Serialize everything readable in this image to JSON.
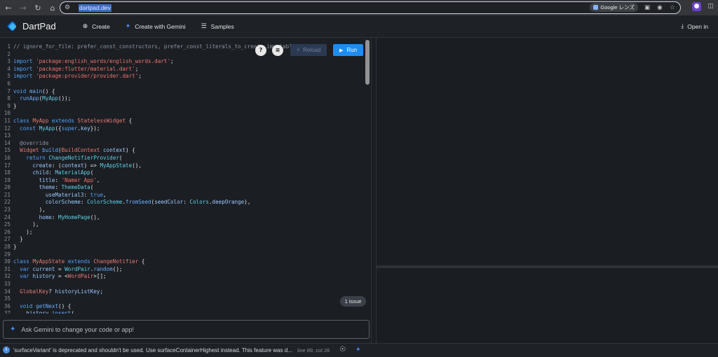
{
  "browser": {
    "url": "dartpad.dev",
    "lens_label": "Google レンズ",
    "icons": [
      "back-icon",
      "forward-icon",
      "reload-icon",
      "home-icon",
      "site-settings-icon",
      "lens-icon",
      "screenshot-icon",
      "incognito-off-icon",
      "bookmark-star-icon",
      "extension-profile-icon",
      "extensions-icon"
    ]
  },
  "header": {
    "brand": "DartPad",
    "create": "Create",
    "create_gemini": "Create with Gemini",
    "samples": "Samples",
    "open_in": "Open in"
  },
  "editor": {
    "reload_label": "Reload",
    "run_label": "Run",
    "issues_label": "1 issue",
    "accent": "#1f8cf0",
    "lines": [
      [
        [
          "c-com",
          "// ignore_for_file: prefer_const_constructors, prefer_const_literals_to_create_immutables"
        ]
      ],
      [],
      [
        [
          "c-kw",
          "import "
        ],
        [
          "c-str",
          "'package:english_words/english_words.dart'"
        ],
        [
          "c-plain",
          ";"
        ]
      ],
      [
        [
          "c-kw",
          "import "
        ],
        [
          "c-str",
          "'package:flutter/material.dart'"
        ],
        [
          "c-plain",
          ";"
        ]
      ],
      [
        [
          "c-kw",
          "import "
        ],
        [
          "c-str",
          "'package:provider/provider.dart'"
        ],
        [
          "c-plain",
          ";"
        ]
      ],
      [],
      [
        [
          "c-kw",
          "void "
        ],
        [
          "c-fn",
          "main"
        ],
        [
          "c-plain",
          "() {"
        ]
      ],
      [
        [
          "c-plain",
          "  "
        ],
        [
          "c-fn",
          "runApp"
        ],
        [
          "c-plain",
          "("
        ],
        [
          "c-cls",
          "MyApp"
        ],
        [
          "c-plain",
          "());"
        ]
      ],
      [
        [
          "c-plain",
          "}"
        ]
      ],
      [],
      [
        [
          "c-kw",
          "class "
        ],
        [
          "c-var",
          "MyApp "
        ],
        [
          "c-kw",
          "extends "
        ],
        [
          "c-var",
          "StatelessWidget "
        ],
        [
          "c-plain",
          "{"
        ]
      ],
      [
        [
          "c-plain",
          "  "
        ],
        [
          "c-kw",
          "const "
        ],
        [
          "c-cls",
          "MyApp"
        ],
        [
          "c-plain",
          "({"
        ],
        [
          "c-kw",
          "super"
        ],
        [
          "c-plain",
          "."
        ],
        [
          "c-prop",
          "key"
        ],
        [
          "c-plain",
          "});"
        ]
      ],
      [],
      [
        [
          "c-anno",
          "  @override"
        ]
      ],
      [
        [
          "c-plain",
          "  "
        ],
        [
          "c-var",
          "Widget "
        ],
        [
          "c-fn",
          "build"
        ],
        [
          "c-plain",
          "("
        ],
        [
          "c-var",
          "BuildContext "
        ],
        [
          "c-prop",
          "context"
        ],
        [
          "c-plain",
          ") {"
        ]
      ],
      [
        [
          "c-plain",
          "    "
        ],
        [
          "c-kw",
          "return "
        ],
        [
          "c-cls",
          "ChangeNotifierProvider"
        ],
        [
          "c-plain",
          "("
        ]
      ],
      [
        [
          "c-plain",
          "      "
        ],
        [
          "c-prop",
          "create"
        ],
        [
          "c-plain",
          ": ("
        ],
        [
          "c-prop",
          "context"
        ],
        [
          "c-plain",
          ") => "
        ],
        [
          "c-cls",
          "MyAppState"
        ],
        [
          "c-plain",
          "(),"
        ]
      ],
      [
        [
          "c-plain",
          "      "
        ],
        [
          "c-prop",
          "child"
        ],
        [
          "c-plain",
          ": "
        ],
        [
          "c-cls",
          "MaterialApp"
        ],
        [
          "c-plain",
          "("
        ]
      ],
      [
        [
          "c-plain",
          "        "
        ],
        [
          "c-prop",
          "title"
        ],
        [
          "c-plain",
          ": "
        ],
        [
          "c-str",
          "'Namer App'"
        ],
        [
          "c-plain",
          ","
        ]
      ],
      [
        [
          "c-plain",
          "        "
        ],
        [
          "c-prop",
          "theme"
        ],
        [
          "c-plain",
          ": "
        ],
        [
          "c-cls",
          "ThemeData"
        ],
        [
          "c-plain",
          "("
        ]
      ],
      [
        [
          "c-plain",
          "          "
        ],
        [
          "c-prop",
          "useMaterial3"
        ],
        [
          "c-plain",
          ": "
        ],
        [
          "c-kw",
          "true"
        ],
        [
          "c-plain",
          ","
        ]
      ],
      [
        [
          "c-plain",
          "          "
        ],
        [
          "c-prop",
          "colorScheme"
        ],
        [
          "c-plain",
          ": "
        ],
        [
          "c-cls",
          "ColorScheme"
        ],
        [
          "c-plain",
          "."
        ],
        [
          "c-fn",
          "fromSeed"
        ],
        [
          "c-plain",
          "("
        ],
        [
          "c-prop",
          "seedColor"
        ],
        [
          "c-plain",
          ": "
        ],
        [
          "c-cls",
          "Colors"
        ],
        [
          "c-plain",
          "."
        ],
        [
          "c-prop",
          "deepOrange"
        ],
        [
          "c-plain",
          "),"
        ]
      ],
      [
        [
          "c-plain",
          "        ),"
        ]
      ],
      [
        [
          "c-plain",
          "        "
        ],
        [
          "c-prop",
          "home"
        ],
        [
          "c-plain",
          ": "
        ],
        [
          "c-cls",
          "MyHomePage"
        ],
        [
          "c-plain",
          "(),"
        ]
      ],
      [
        [
          "c-plain",
          "      ),"
        ]
      ],
      [
        [
          "c-plain",
          "    );"
        ]
      ],
      [
        [
          "c-plain",
          "  }"
        ]
      ],
      [
        [
          "c-plain",
          "}"
        ]
      ],
      [],
      [
        [
          "c-kw",
          "class "
        ],
        [
          "c-var",
          "MyAppState "
        ],
        [
          "c-kw",
          "extends "
        ],
        [
          "c-var",
          "ChangeNotifier "
        ],
        [
          "c-plain",
          "{"
        ]
      ],
      [
        [
          "c-plain",
          "  "
        ],
        [
          "c-kw",
          "var "
        ],
        [
          "c-prop",
          "current"
        ],
        [
          "c-plain",
          " = "
        ],
        [
          "c-cls",
          "WordPair"
        ],
        [
          "c-plain",
          "."
        ],
        [
          "c-fn",
          "random"
        ],
        [
          "c-plain",
          "();"
        ]
      ],
      [
        [
          "c-plain",
          "  "
        ],
        [
          "c-kw",
          "var "
        ],
        [
          "c-prop",
          "history"
        ],
        [
          "c-plain",
          " = <"
        ],
        [
          "c-var",
          "WordPair"
        ],
        [
          "c-plain",
          ">[];"
        ]
      ],
      [],
      [
        [
          "c-plain",
          "  "
        ],
        [
          "c-var",
          "GlobalKey"
        ],
        [
          "c-plain",
          "? "
        ],
        [
          "c-prop",
          "historyListKey"
        ],
        [
          "c-plain",
          ";"
        ]
      ],
      [],
      [
        [
          "c-plain",
          "  "
        ],
        [
          "c-kw",
          "void "
        ],
        [
          "c-fn",
          "getNext"
        ],
        [
          "c-plain",
          "() {"
        ]
      ],
      [
        [
          "c-plain",
          "    "
        ],
        [
          "c-prop",
          "history"
        ],
        [
          "c-plain",
          "."
        ],
        [
          "c-fn",
          "insert"
        ],
        [
          "c-plain",
          "("
        ]
      ]
    ]
  },
  "gemini": {
    "placeholder": "Ask Gemini to change your code or app!"
  },
  "status": {
    "message": "'surfaceVariant' is deprecated and shouldn't be used. Use surfaceContainerHighest instead. This feature was d...",
    "position": "line 89, col 26"
  }
}
